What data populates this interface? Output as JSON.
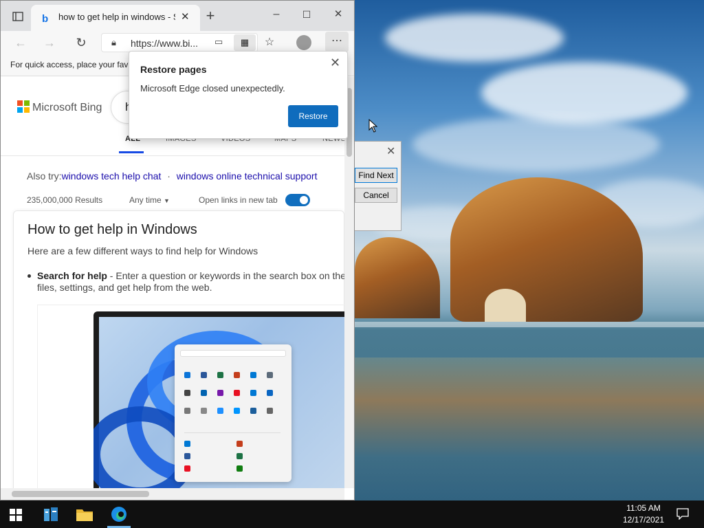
{
  "browser": {
    "tab_title": "how to get help in windows - Se",
    "address": "https://www.bi...",
    "favorites_bar_text": "For quick access, place your fav"
  },
  "bing": {
    "logo_text": "Microsoft Bing",
    "search_partial": "h",
    "nav_tabs": [
      "ALL",
      "IMAGES",
      "VIDEOS",
      "MAPS",
      "NEWS"
    ],
    "also_try_label": "Also try:",
    "also_try_links": [
      "windows tech help chat",
      "windows online technical support"
    ],
    "also_try_sep": "·",
    "results_count": "235,000,000 Results",
    "time_filter": "Any time",
    "open_links_label": "Open links in new tab",
    "open_links_on": true,
    "card_title": "How to get help in Windows",
    "card_subtitle": "Here are a few different ways to find help for Windows",
    "bullet_bold": "Search for help",
    "bullet_text": " - Enter a question or keywords in the search box on the t files, settings, and get help from the web."
  },
  "restore_popup": {
    "title": "Restore pages",
    "message": "Microsoft Edge closed unexpectedly.",
    "button": "Restore"
  },
  "find_dialog": {
    "find_next": "Find Next",
    "cancel": "Cancel"
  },
  "taskbar": {
    "time": "11:05 AM",
    "date": "12/17/2021"
  },
  "colors": {
    "accent": "#0f6cbd",
    "link": "#1a0dab",
    "taskbar": "#101010"
  }
}
